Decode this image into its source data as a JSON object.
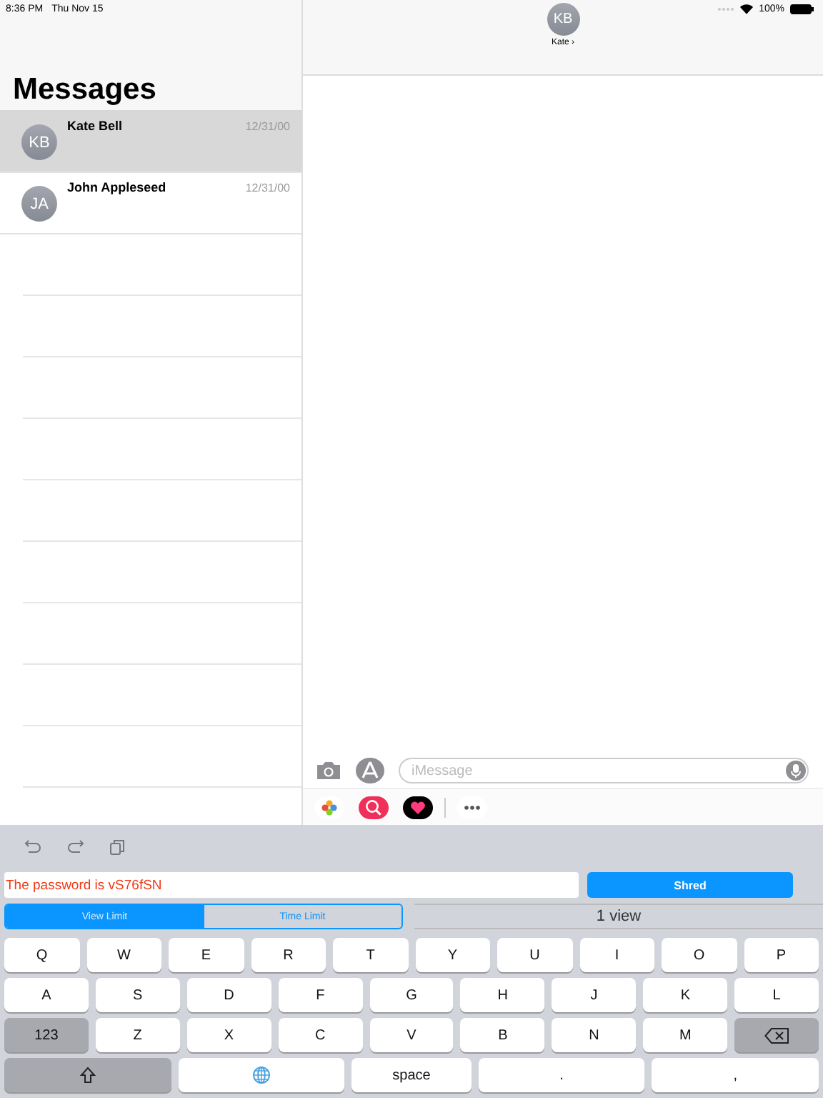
{
  "status_bar": {
    "time": "8:36 PM",
    "date": "Thu Nov 15",
    "battery": "100%"
  },
  "sidebar": {
    "title": "Messages",
    "conversations": [
      {
        "initials": "KB",
        "name": "Kate Bell",
        "date": "12/31/00",
        "selected": true
      },
      {
        "initials": "JA",
        "name": "John Appleseed",
        "date": "12/31/00",
        "selected": false
      }
    ]
  },
  "conversation": {
    "initials": "KB",
    "contact": "Kate",
    "chevron": "›",
    "placeholder": "iMessage"
  },
  "extension": {
    "message": "The password is vS76fSN",
    "button": "Shred",
    "segments": [
      {
        "label": "View Limit",
        "selected": true
      },
      {
        "label": "Time Limit",
        "selected": false
      }
    ],
    "value": "1 view"
  },
  "keyboard": [
    [
      {
        "kind": "letter",
        "label": "Q"
      },
      {
        "kind": "letter",
        "label": "W"
      },
      {
        "kind": "letter",
        "label": "E"
      },
      {
        "kind": "letter",
        "label": "R"
      },
      {
        "kind": "letter",
        "label": "T"
      },
      {
        "kind": "letter",
        "label": "Y"
      },
      {
        "kind": "letter",
        "label": "U"
      },
      {
        "kind": "letter",
        "label": "I"
      },
      {
        "kind": "letter",
        "label": "O"
      },
      {
        "kind": "letter",
        "label": "P"
      }
    ],
    [
      {
        "kind": "letter",
        "label": "A"
      },
      {
        "kind": "letter",
        "label": "S"
      },
      {
        "kind": "letter",
        "label": "D"
      },
      {
        "kind": "letter",
        "label": "F"
      },
      {
        "kind": "letter",
        "label": "G"
      },
      {
        "kind": "letter",
        "label": "H"
      },
      {
        "kind": "letter",
        "label": "J"
      },
      {
        "kind": "letter",
        "label": "K"
      },
      {
        "kind": "letter",
        "label": "L"
      }
    ],
    [
      {
        "kind": "mode",
        "label": "123"
      },
      {
        "kind": "letter",
        "label": "Z"
      },
      {
        "kind": "letter",
        "label": "X"
      },
      {
        "kind": "letter",
        "label": "C"
      },
      {
        "kind": "letter",
        "label": "V"
      },
      {
        "kind": "letter",
        "label": "B"
      },
      {
        "kind": "letter",
        "label": "N"
      },
      {
        "kind": "letter",
        "label": "M"
      },
      {
        "kind": "delete"
      }
    ],
    [
      {
        "kind": "shift"
      },
      {
        "kind": "globe"
      },
      {
        "kind": "space",
        "label": "space"
      },
      {
        "kind": "punct",
        "label": "."
      },
      {
        "kind": "punct",
        "label": ","
      }
    ]
  ]
}
